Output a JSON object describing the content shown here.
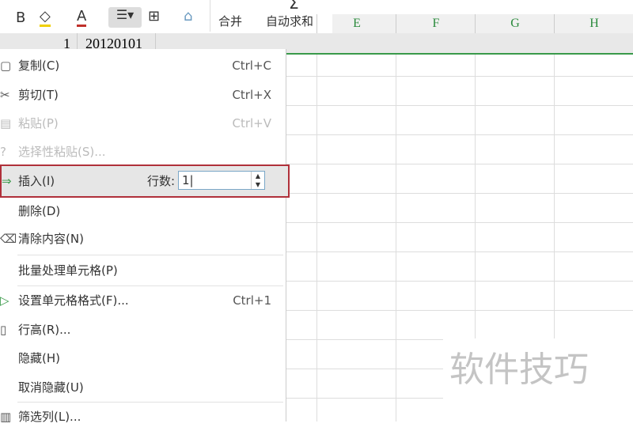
{
  "toolbar": {
    "bold": "B",
    "font_color": "A",
    "merge": "合并",
    "autosum": "自动求和",
    "autosum_icon": "Σ"
  },
  "columns": [
    "E",
    "F",
    "G",
    "H"
  ],
  "row1": {
    "number": "1",
    "value": "20120101"
  },
  "menu": {
    "items": [
      {
        "label": "复制(C)",
        "shortcut": "Ctrl+C"
      },
      {
        "label": "剪切(T)",
        "shortcut": "Ctrl+X"
      },
      {
        "label": "粘贴(P)",
        "shortcut": "Ctrl+V"
      },
      {
        "label": "选择性粘贴(S)..."
      },
      {
        "label": "插入(I)",
        "rows_label": "行数:",
        "rows_value": "1"
      },
      {
        "label": "删除(D)"
      },
      {
        "label": "清除内容(N)"
      },
      {
        "label": "批量处理单元格(P)"
      },
      {
        "label": "设置单元格格式(F)...",
        "shortcut": "Ctrl+1"
      },
      {
        "label": "行高(R)..."
      },
      {
        "label": "隐藏(H)"
      },
      {
        "label": "取消隐藏(U)"
      },
      {
        "label": "筛选列(L)..."
      }
    ]
  },
  "watermark": "软件技巧",
  "colors": {
    "accent": "#3a9a4a",
    "highlight_border": "#b0303a"
  }
}
